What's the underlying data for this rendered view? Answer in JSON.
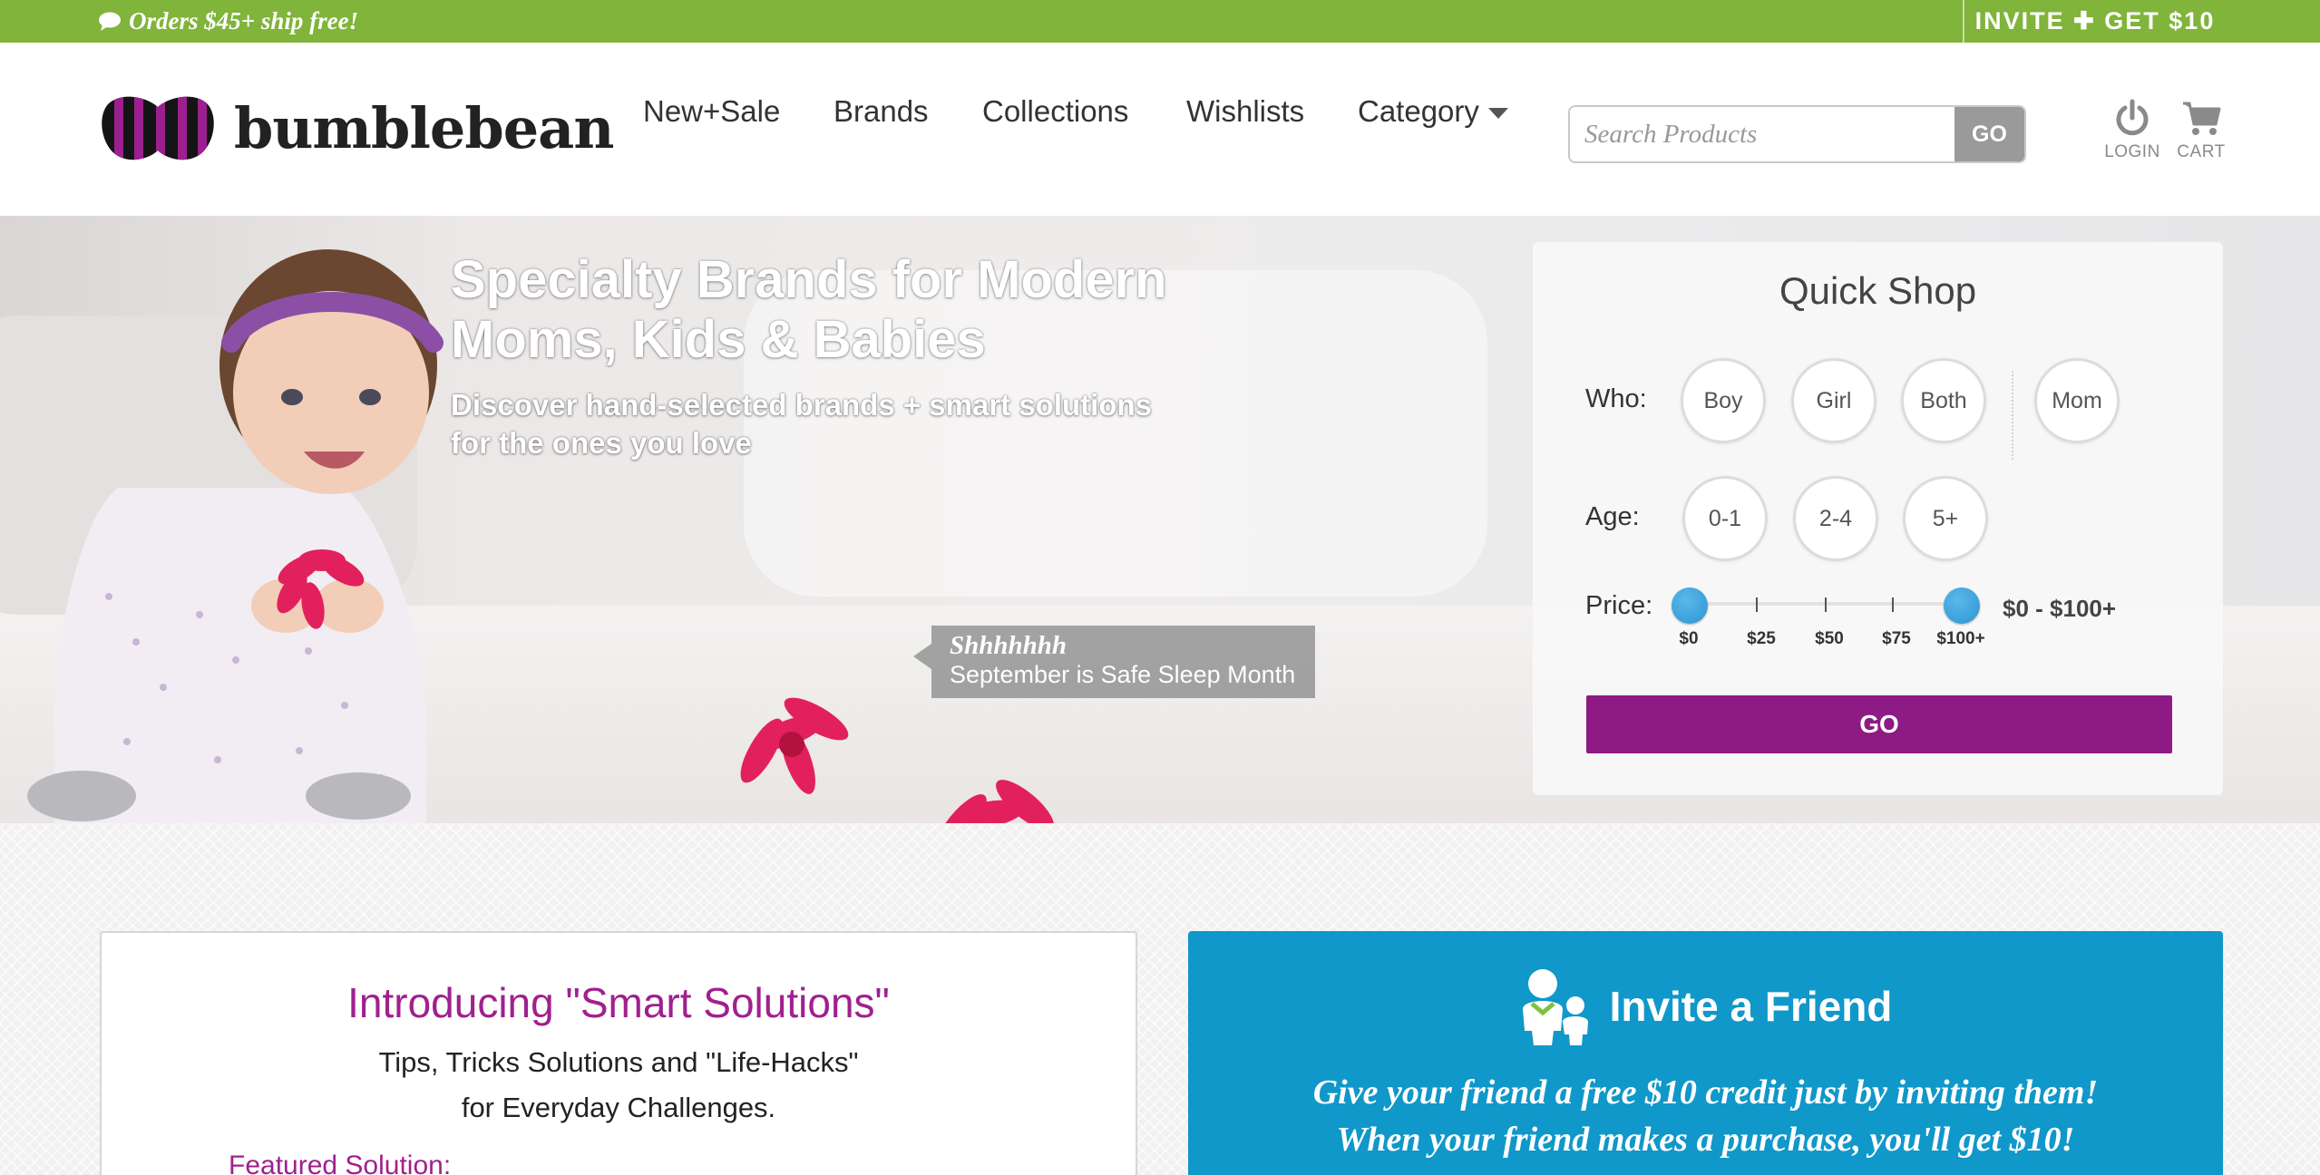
{
  "promo_bar": {
    "left_icon": "chat-bubble-icon",
    "shipping_text": "Orders $45+ ship free!",
    "invite_text": "INVITE ✚ GET $10"
  },
  "header": {
    "logo_text": "bumblebean",
    "nav": [
      "New+Sale",
      "Brands",
      "Collections",
      "Wishlists",
      "Category"
    ],
    "search_placeholder": "Search Products",
    "search_button": "GO",
    "login_label": "LOGIN",
    "cart_label": "CART"
  },
  "hero": {
    "title": "Specialty Brands for Modern Moms, Kids & Babies",
    "subtitle": "Discover hand-selected brands + smart solutions for the ones you love",
    "tag_title": "Shhhhhhh",
    "tag_text": "September is Safe Sleep Month"
  },
  "quick_shop": {
    "title": "Quick Shop",
    "who_label": "Who:",
    "who_options": [
      "Boy",
      "Girl",
      "Both",
      "Mom"
    ],
    "age_label": "Age:",
    "age_options": [
      "0-1",
      "2-4",
      "5+"
    ],
    "price_label": "Price:",
    "price_ticks": [
      "$0",
      "$25",
      "$50",
      "$75",
      "$100+"
    ],
    "price_range": "$0 - $100+",
    "price_min_fraction": 0,
    "price_max_fraction": 1,
    "go_button": "GO",
    "accent": "#8e1a85",
    "slider_color": "#2a95d2"
  },
  "smart_solutions": {
    "title": "Introducing \"Smart Solutions\"",
    "line1": "Tips, Tricks Solutions and \"Life-Hacks\"",
    "line2": "for Everyday Challenges.",
    "featured": "Featured Solution:"
  },
  "invite_friend": {
    "icon": "people-icon",
    "title": "Invite a Friend",
    "line1": "Give your friend a free $10 credit just by inviting them!",
    "line2": "When your friend makes a purchase, you'll get $10!",
    "bg_color": "#0f98c9"
  },
  "colors": {
    "promo_green": "#80b43a",
    "brand_purple": "#a0208e"
  }
}
